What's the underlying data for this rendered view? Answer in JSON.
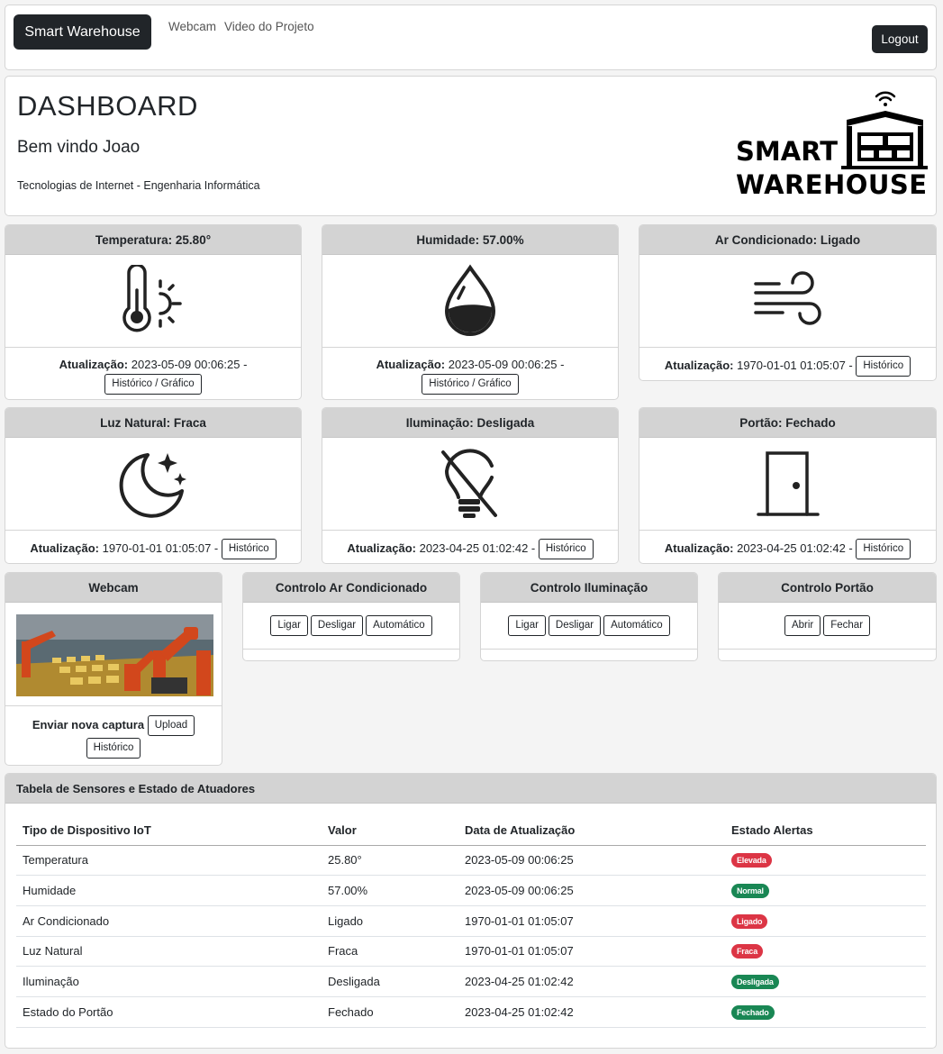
{
  "nav": {
    "brand": "Smart Warehouse",
    "links": [
      "Webcam",
      "Video do Projeto"
    ],
    "logout": "Logout"
  },
  "hero": {
    "title": "DASHBOARD",
    "welcome": "Bem vindo Joao",
    "subtitle": "Tecnologias de Internet - Engenharia Informática",
    "logo_line1": "SMART",
    "logo_line2": "WAREHOUSE"
  },
  "update_label": "Atualização:",
  "sensors": [
    {
      "title": "Temperatura: 25.80°",
      "icon": "thermometer-sun-icon",
      "time": "2023-05-09 00:06:25 -",
      "button": "Histórico / Gráfico"
    },
    {
      "title": "Humidade: 57.00%",
      "icon": "water-drop-icon",
      "time": "2023-05-09 00:06:25 -",
      "button": "Histórico / Gráfico"
    },
    {
      "title": "Ar Condicionado: Ligado",
      "icon": "wind-icon",
      "time": "1970-01-01 01:05:07 -",
      "button": "Histórico"
    },
    {
      "title": "Luz Natural: Fraca",
      "icon": "moon-stars-icon",
      "time": "1970-01-01 01:05:07 -",
      "button": "Histórico"
    },
    {
      "title": "Iluminação: Desligada",
      "icon": "lightbulb-off-icon",
      "time": "2023-04-25 01:02:42 -",
      "button": "Histórico"
    },
    {
      "title": "Portão: Fechado",
      "icon": "door-closed-icon",
      "time": "2023-04-25 01:02:42 -",
      "button": "Histórico"
    }
  ],
  "webcam": {
    "title": "Webcam",
    "send_label": "Enviar nova captura",
    "upload": "Upload",
    "history": "Histórico"
  },
  "controls": [
    {
      "title": "Controlo Ar Condicionado",
      "buttons": [
        "Ligar",
        "Desligar",
        "Automático"
      ]
    },
    {
      "title": "Controlo Iluminação",
      "buttons": [
        "Ligar",
        "Desligar",
        "Automático"
      ]
    },
    {
      "title": "Controlo Portão",
      "buttons": [
        "Abrir",
        "Fechar"
      ]
    }
  ],
  "table": {
    "title": "Tabela de Sensores e Estado de Atuadores",
    "columns": [
      "Tipo de Dispositivo IoT",
      "Valor",
      "Data de Atualização",
      "Estado Alertas"
    ],
    "rows": [
      {
        "device": "Temperatura",
        "value": "25.80°",
        "date": "2023-05-09 00:06:25",
        "alert": "Elevada",
        "color": "#dc3545"
      },
      {
        "device": "Humidade",
        "value": "57.00%",
        "date": "2023-05-09 00:06:25",
        "alert": "Normal",
        "color": "#198754"
      },
      {
        "device": "Ar Condicionado",
        "value": "Ligado",
        "date": "1970-01-01 01:05:07",
        "alert": "Ligado",
        "color": "#dc3545"
      },
      {
        "device": "Luz Natural",
        "value": "Fraca",
        "date": "1970-01-01 01:05:07",
        "alert": "Fraca",
        "color": "#dc3545"
      },
      {
        "device": "Iluminação",
        "value": "Desligada",
        "date": "2023-04-25 01:02:42",
        "alert": "Desligada",
        "color": "#198754"
      },
      {
        "device": "Estado do Portão",
        "value": "Fechado",
        "date": "2023-04-25 01:02:42",
        "alert": "Fechado",
        "color": "#198754"
      }
    ]
  }
}
